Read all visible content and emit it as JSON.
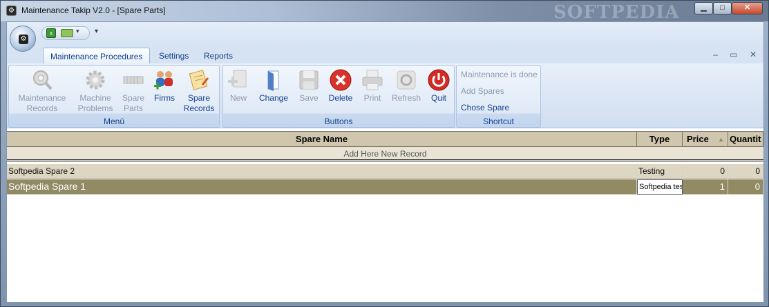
{
  "window": {
    "title": "Maintenance Takip V2.0 - [Spare Parts]",
    "watermark": "SOFTPEDIA",
    "controls": {
      "minimize": "▁",
      "maximize": "□",
      "close": "✕"
    }
  },
  "qat": {
    "customize": "▾"
  },
  "tabs": [
    {
      "label": "Maintenance Procedures",
      "active": true
    },
    {
      "label": "Settings",
      "active": false
    },
    {
      "label": "Reports",
      "active": false
    }
  ],
  "mdi": {
    "minimize": "–",
    "restore": "▭",
    "close": "✕"
  },
  "ribbon": {
    "groups": {
      "menu": {
        "label": "Menü",
        "buttons": [
          {
            "label1": "Maintenance",
            "label2": "Records",
            "icon": "gear-search-icon",
            "enabled": false
          },
          {
            "label1": "Machine",
            "label2": "Problems",
            "icon": "gear-icon",
            "enabled": false
          },
          {
            "label1": "Spare",
            "label2": "Parts",
            "icon": "parts-icon",
            "enabled": false
          },
          {
            "label1": "Firms",
            "label2": "",
            "icon": "users-icon",
            "enabled": true
          },
          {
            "label1": "Spare",
            "label2": "Records",
            "icon": "notes-icon",
            "enabled": true
          }
        ]
      },
      "buttons": {
        "label": "Buttons",
        "items": [
          {
            "label": "New",
            "icon": "new-icon",
            "enabled": false
          },
          {
            "label": "Change",
            "icon": "change-icon",
            "enabled": true
          },
          {
            "label": "Save",
            "icon": "save-icon",
            "enabled": false
          },
          {
            "label": "Delete",
            "icon": "delete-icon",
            "enabled": true
          },
          {
            "label": "Print",
            "icon": "print-icon",
            "enabled": false
          },
          {
            "label": "Refresh",
            "icon": "refresh-icon",
            "enabled": false
          },
          {
            "label": "Quit",
            "icon": "power-icon",
            "enabled": true
          }
        ]
      },
      "shortcut": {
        "label": "Shortcut",
        "items": [
          {
            "label": "Maintenance is done",
            "enabled": false
          },
          {
            "label": "Add Spares",
            "enabled": false
          },
          {
            "label": "Chose Spare",
            "enabled": true
          }
        ]
      }
    }
  },
  "grid": {
    "columns": [
      "Spare Name",
      "Type",
      "Price",
      "Quantit"
    ],
    "sort_indicator": "▲",
    "new_record_prompt": "Add Here New Record",
    "rows": [
      {
        "name": "Softpedia Spare 2",
        "type": "Testing",
        "price": "0",
        "quantity": "0"
      },
      {
        "name": "Softpedia Spare 1",
        "type": "Softpedia tes",
        "price": "1",
        "quantity": "0"
      }
    ]
  }
}
